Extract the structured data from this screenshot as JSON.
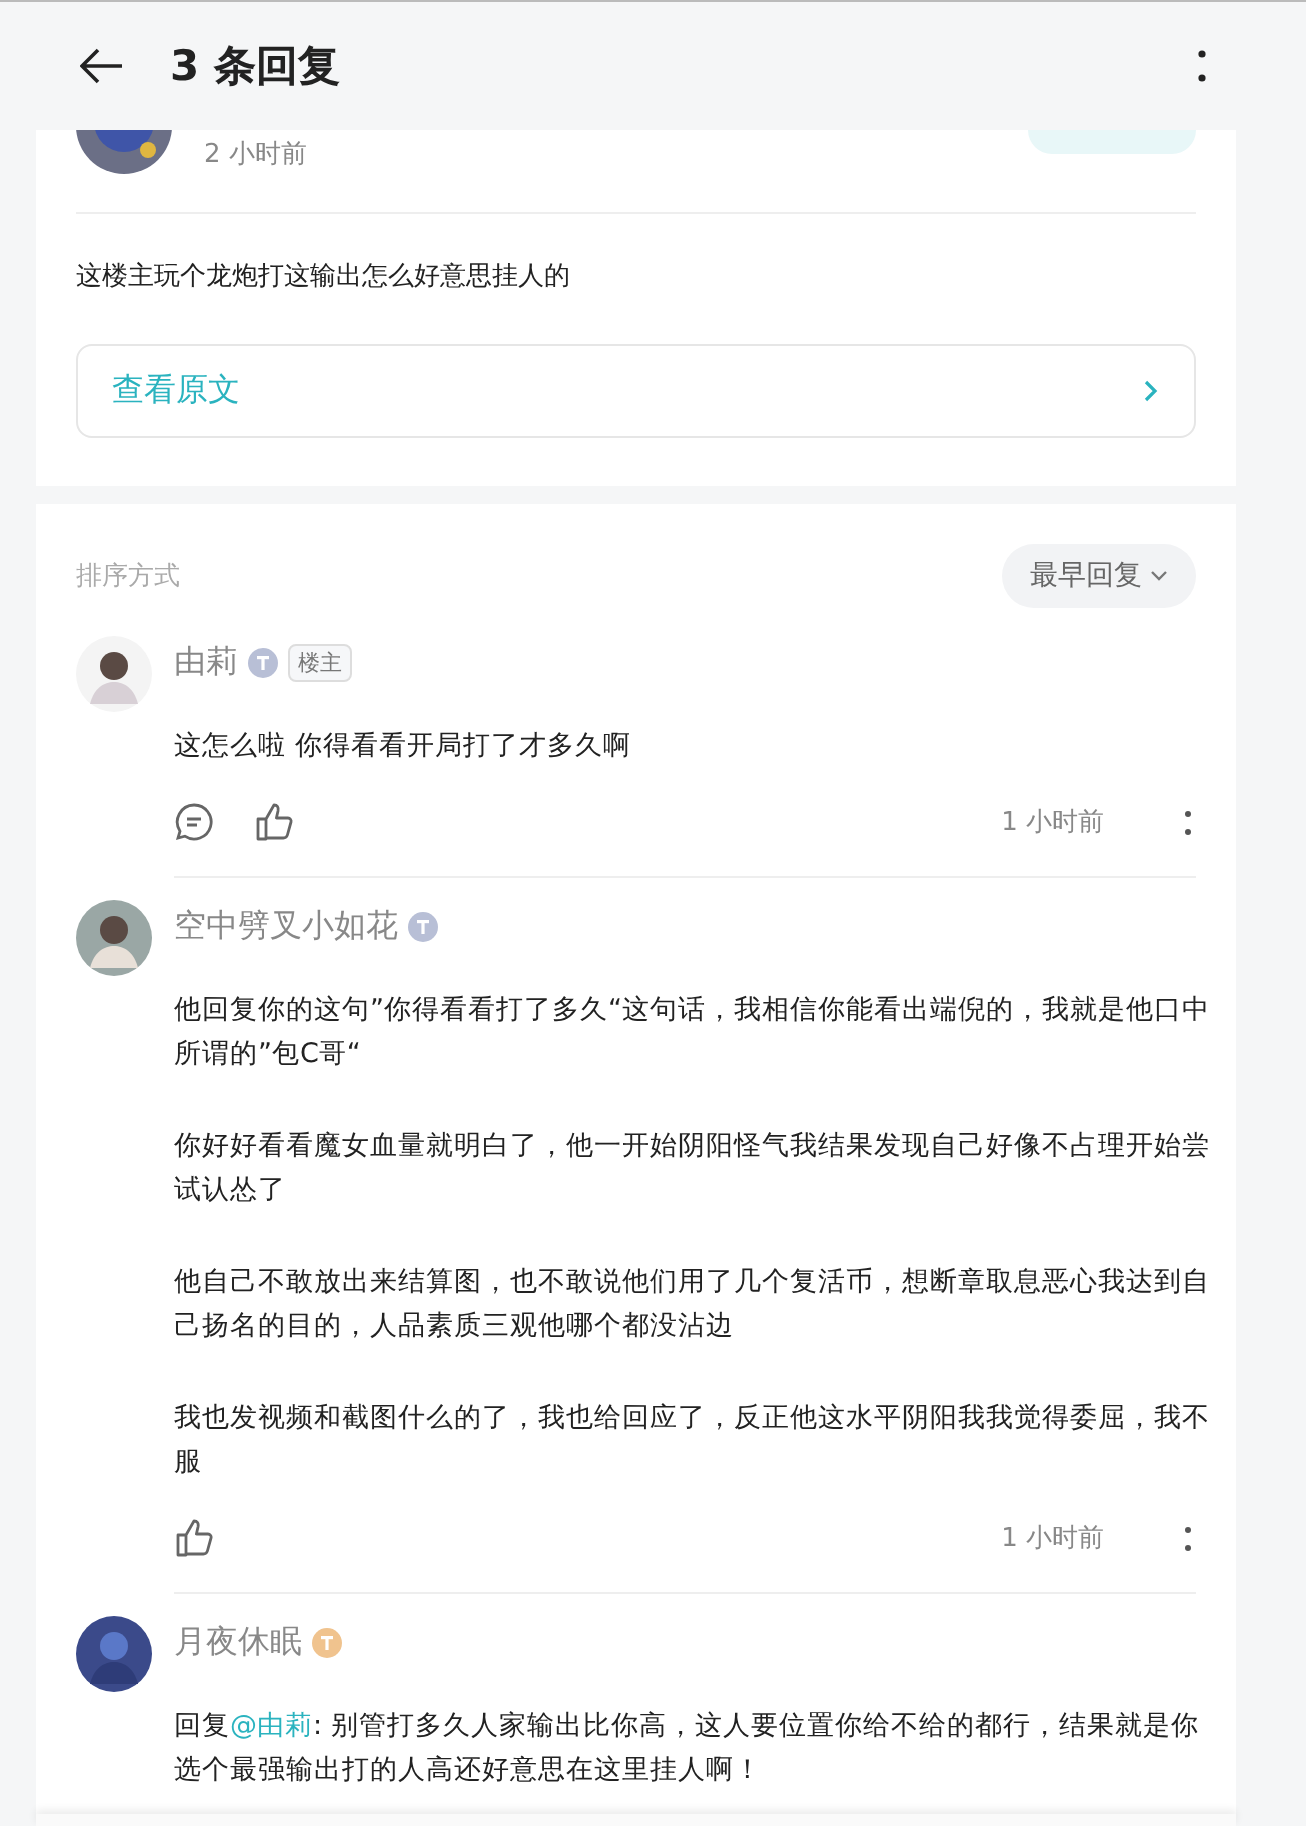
{
  "header": {
    "title": "3 条回复"
  },
  "original_post": {
    "time": "2 小时前",
    "text": "这楼主玩个龙炮打这输出怎么好意思挂人的",
    "view_original": "查看原文"
  },
  "sort": {
    "label": "排序方式",
    "value": "最早回复"
  },
  "comments": [
    {
      "author": "由莉",
      "badge": {
        "color": "#b8bfd6"
      },
      "op_tag": "楼主",
      "paragraphs": [
        "这怎么啦 你得看看开局打了才多久啊"
      ],
      "actions": [
        {
          "kind": "reply"
        },
        {
          "kind": "like"
        }
      ],
      "time": "1 小时前"
    },
    {
      "author": "空中劈叉小如花",
      "badge": {
        "color": "#b8bfd6"
      },
      "paragraphs": [
        "他回复你的这句”你得看看打了多久“这句话，我相信你能看出端倪的，我就是他口中所谓的”包C哥“",
        "你好好看看魔女血量就明白了，他一开始阴阳怪气我结果发现自己好像不占理开始尝试认怂了",
        "他自己不敢放出来结算图，也不敢说他们用了几个复活币，想断章取息恶心我达到自己扬名的目的，人品素质三观他哪个都没沾边",
        "我也发视频和截图什么的了，我也给回应了，反正他这水平阴阳我我觉得委屈，我不服"
      ],
      "actions": [
        {
          "kind": "like"
        }
      ],
      "time": "1 小时前"
    },
    {
      "author": "月夜休眠",
      "badge": {
        "color": "#f0c38e"
      },
      "reply": {
        "prefix": "回复",
        "mention": "@由莉",
        "text": ": 别管打多久人家输出比你高，这人要位置你给不给的都行，结果就是你选个最强输出打的人高还好意思在这里挂人啊！"
      }
    }
  ]
}
